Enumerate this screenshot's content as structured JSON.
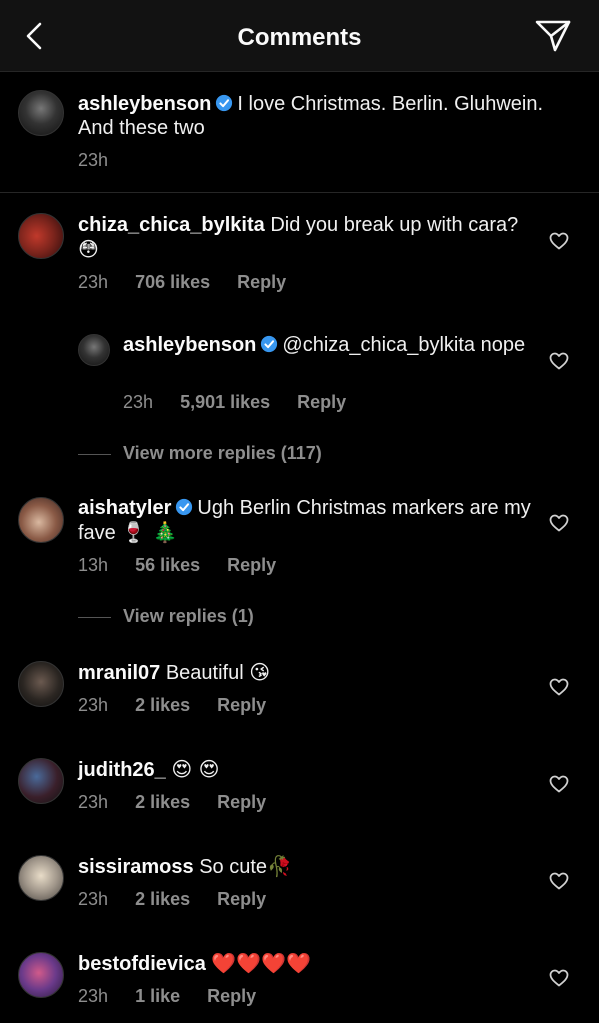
{
  "header": {
    "title": "Comments",
    "back_icon": "chevron-left-icon",
    "send_icon": "paper-plane-icon"
  },
  "caption": {
    "username": "ashleybenson",
    "text": "I love Christmas. Berlin. Gluhwein. And these two",
    "time": "23h"
  },
  "comments": [
    {
      "username": "chiza_chica_bylkita",
      "text": "Did you break up with cara?",
      "emoji": "😳",
      "time": "23h",
      "likes": "706 likes",
      "reply": "Reply"
    },
    {
      "username": "ashleybenson",
      "mention": "@chiza_chica_bylkita",
      "text": "nope",
      "time": "23h",
      "likes": "5,901 likes",
      "reply": "Reply"
    },
    {
      "username": "aishatyler",
      "text": "Ugh Berlin Christmas markers are my fave",
      "emoji": "🍷 🎄",
      "time": "13h",
      "likes": "56 likes",
      "reply": "Reply"
    },
    {
      "username": "mranil07",
      "text": "Beautiful",
      "emoji": "😘",
      "time": "23h",
      "likes": "2 likes",
      "reply": "Reply"
    },
    {
      "username": "judith26_",
      "text": "",
      "emoji": "😍 😍",
      "time": "23h",
      "likes": "2 likes",
      "reply": "Reply"
    },
    {
      "username": "sissiramoss",
      "text": "So cute",
      "emoji": "🥀",
      "time": "23h",
      "likes": "2 likes",
      "reply": "Reply"
    },
    {
      "username": "bestofdievica",
      "text": "",
      "emoji": "❤️❤️❤️❤️",
      "time": "23h",
      "likes": "1 like",
      "reply": "Reply"
    }
  ],
  "view_more_replies": "View more replies (117)",
  "view_replies": "View replies (1)",
  "colors": {
    "background": "#000000",
    "header": "#121212",
    "verified": "#3897f0",
    "meta": "#8e8e8e"
  }
}
